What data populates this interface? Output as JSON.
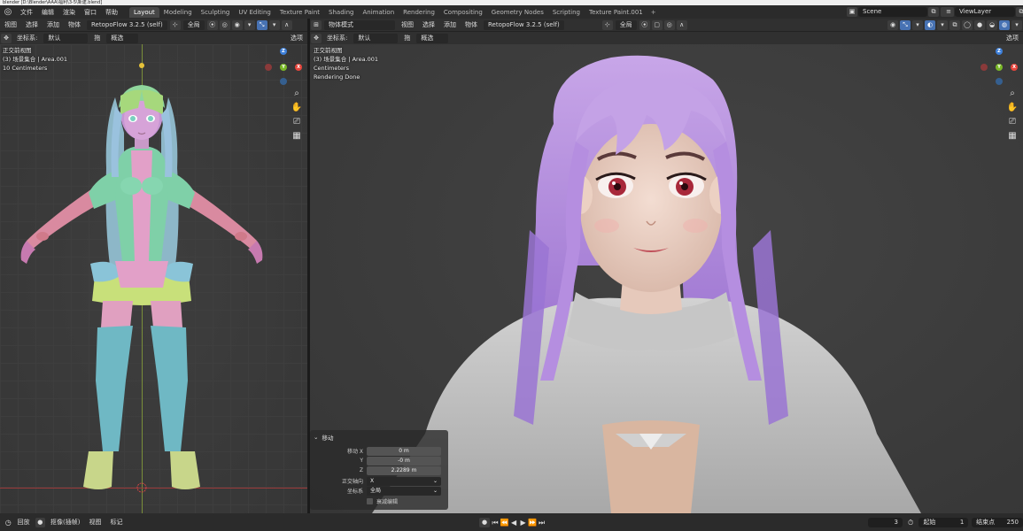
{
  "window": {
    "title": "blender [D:\\Blender\\AAA\\福利\\3-5\\新建.blend]"
  },
  "menu": [
    "文件",
    "编辑",
    "渲染",
    "窗口",
    "帮助"
  ],
  "workspaces": [
    "Layout",
    "Modeling",
    "Sculpting",
    "UV Editing",
    "Texture Paint",
    "Shading",
    "Animation",
    "Rendering",
    "Compositing",
    "Geometry Nodes",
    "Scripting",
    "Texture Paint.001"
  ],
  "active_workspace": "Layout",
  "scene": {
    "label": "Scene",
    "view_layer": "ViewLayer"
  },
  "left_view": {
    "header_menus": [
      "视图",
      "选择",
      "添加",
      "物体"
    ],
    "addon": "RetopoFlow 3.2.5 (self)",
    "transform_global": "全局",
    "coord_label": "坐标系:",
    "coord_value": "默认",
    "drag_label": "拖",
    "select_mode": "概选",
    "options": "选项",
    "overlay": {
      "line1": "正交前视图",
      "line2": "(3) 场景集合 | Area.001",
      "line3": "10 Centimeters"
    }
  },
  "right_view": {
    "mode": "物体模式",
    "header_menus": [
      "视图",
      "选择",
      "添加",
      "物体"
    ],
    "addon": "RetopoFlow 3.2.5 (self)",
    "transform_global": "全局",
    "coord_label": "坐标系:",
    "coord_value": "默认",
    "drag_label": "拖",
    "select_mode": "概选",
    "options": "选项",
    "overlay": {
      "line1": "正交前视图",
      "line2": "(3) 场景集合 | Area.001",
      "line3": "Centimeters",
      "line4": "Rendering Done"
    }
  },
  "operator_panel": {
    "title": "移动",
    "move_x_label": "移动 X",
    "x": "0 m",
    "y_label": "Y",
    "y": "-0 m",
    "z_label": "Z",
    "z": "2.2289 m",
    "ortho_label": "正交轴向",
    "ortho_value": "X",
    "coord_label": "坐标系",
    "coord_value": "全局",
    "falloff_label": "衰减编辑"
  },
  "timeline": {
    "playback": "回放",
    "keying": "抠像(插帧)",
    "view": "视图",
    "marker": "标记",
    "current_frame": "3",
    "start_label": "起始",
    "start": "1",
    "end_label": "结束点",
    "end": "250"
  },
  "gizmo": {
    "z": "Z",
    "y": "Y",
    "x": "X"
  },
  "colors": {
    "x_axis": "#e8453c",
    "y_axis": "#7ab827",
    "z_axis": "#3d7fd9",
    "active_blue": "#4772b3"
  }
}
